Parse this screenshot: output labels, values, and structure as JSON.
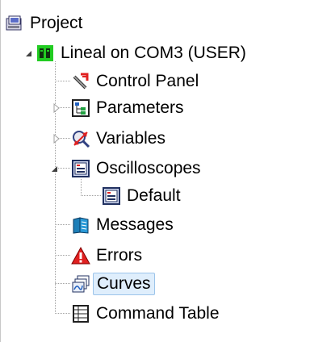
{
  "tree": {
    "root": {
      "label": "Project",
      "icon": "project-icon"
    },
    "device": {
      "label": "Lineal on COM3 (USER)",
      "icon": "device-icon",
      "expanded": true
    },
    "items": [
      {
        "key": "control_panel",
        "label": "Control Panel",
        "icon": "control-panel-icon"
      },
      {
        "key": "parameters",
        "label": "Parameters",
        "icon": "parameters-icon",
        "expandable": true,
        "expanded": false
      },
      {
        "key": "variables",
        "label": "Variables",
        "icon": "variables-icon",
        "expandable": true,
        "expanded": false
      },
      {
        "key": "oscilloscopes",
        "label": "Oscilloscopes",
        "icon": "oscilloscope-icon",
        "expandable": true,
        "expanded": true,
        "children": [
          {
            "key": "default",
            "label": "Default",
            "icon": "oscilloscope-icon"
          }
        ]
      },
      {
        "key": "messages",
        "label": "Messages",
        "icon": "messages-icon"
      },
      {
        "key": "errors",
        "label": "Errors",
        "icon": "warning-icon"
      },
      {
        "key": "curves",
        "label": "Curves",
        "icon": "curves-icon",
        "selected": true
      },
      {
        "key": "command_table",
        "label": "Command Table",
        "icon": "command-table-icon"
      }
    ]
  },
  "colors": {
    "selection_bg": "#dfeefc",
    "selection_border": "#9cc4ea",
    "tree_line": "#a0a0a0",
    "warning_red": "#e02020",
    "device_green": "#22cc22"
  }
}
